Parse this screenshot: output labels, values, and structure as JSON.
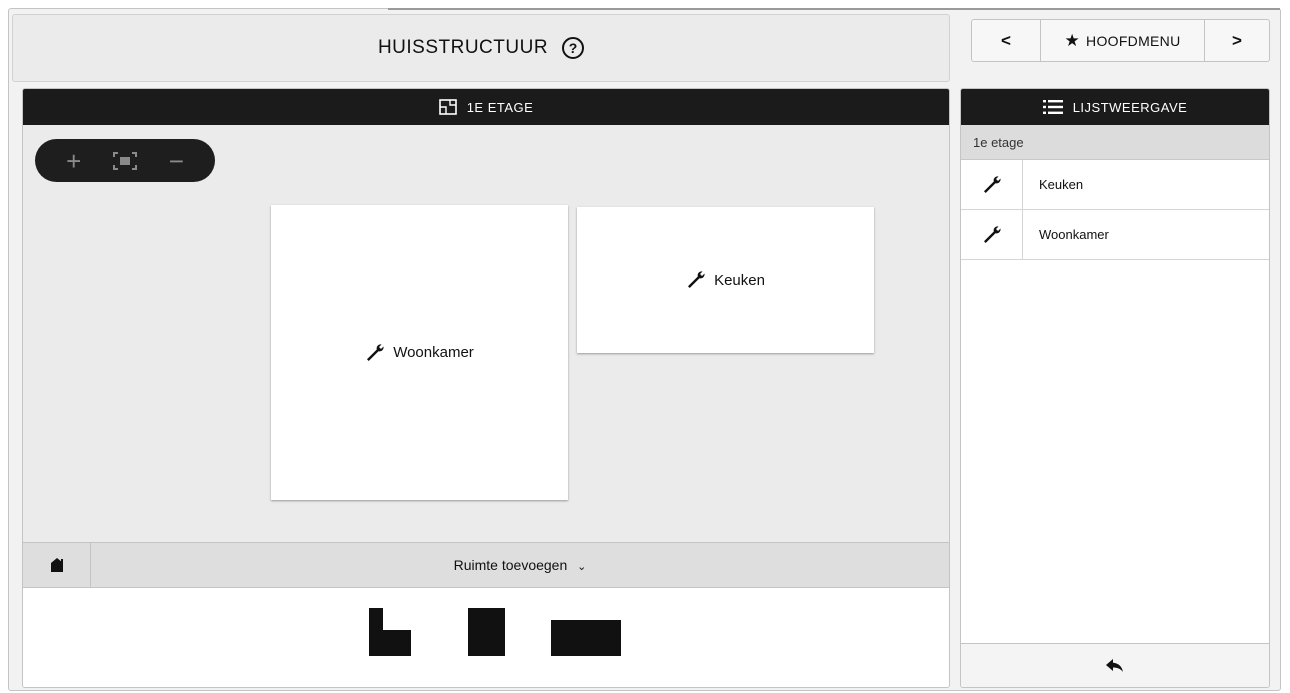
{
  "header": {
    "title": "HUISSTRUCTUUR",
    "help_icon": "?"
  },
  "nav": {
    "prev_label": "<",
    "main_label": "HOOFDMENU",
    "main_icon": "★",
    "next_label": ">"
  },
  "floor_panel": {
    "title": "1E ETAGE",
    "zoom_in": "+",
    "zoom_out": "−",
    "rooms": [
      {
        "name": "Woonkamer"
      },
      {
        "name": "Keuken"
      }
    ],
    "add_room_label": "Ruimte toevoegen",
    "add_room_chevron": "⌄"
  },
  "list_panel": {
    "title": "LIJSTWEERGAVE",
    "group_label": "1e etage",
    "items": [
      {
        "label": "Keuken"
      },
      {
        "label": "Woonkamer"
      }
    ]
  },
  "colors": {
    "header_bg": "#1b1b1b",
    "panel_bg": "#ebebeb",
    "accent": "#111111"
  }
}
